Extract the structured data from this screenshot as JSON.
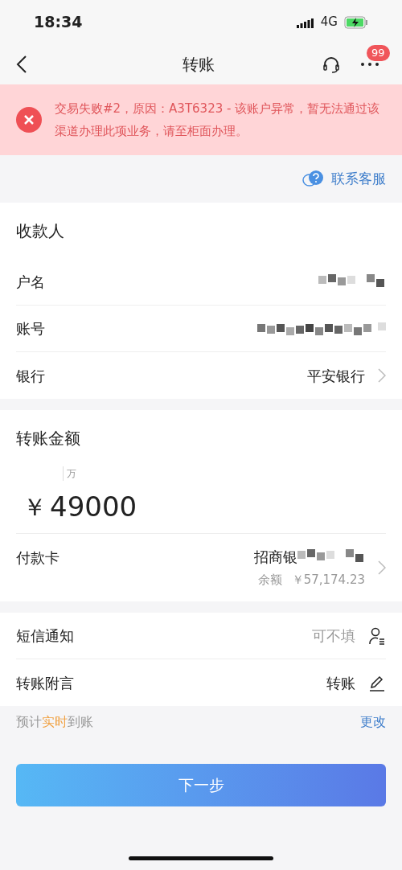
{
  "status_bar": {
    "time": "18:34",
    "network": "4G"
  },
  "nav": {
    "title": "转账",
    "badge": "99"
  },
  "error_banner": {
    "message": "交易失败#2，原因：A3T6323 - 该账户异常，暂无法通过该渠道办理此项业务，请至柜面办理。"
  },
  "contact_link": "联系客服",
  "payee": {
    "title": "收款人",
    "rows": [
      {
        "label": "户名",
        "kind": "redacted"
      },
      {
        "label": "账号",
        "kind": "redacted"
      },
      {
        "label": "银行",
        "kind": "link",
        "value": "平安银行"
      }
    ]
  },
  "amount": {
    "title": "转账金额",
    "unit_hint": "万",
    "currency": "￥",
    "value": "49000"
  },
  "pay_card": {
    "label": "付款卡",
    "bank": "招商银",
    "balance_label": "余额",
    "balance": "￥57,174.23"
  },
  "options": [
    {
      "label": "短信通知",
      "placeholder": "可不填",
      "kind": "contact"
    },
    {
      "label": "转账附言",
      "value": "转账",
      "kind": "edit"
    }
  ],
  "arrival": {
    "before": "预计",
    "highlight": "实时",
    "after": "到账",
    "action": "更改"
  },
  "next_button": "下一步"
}
